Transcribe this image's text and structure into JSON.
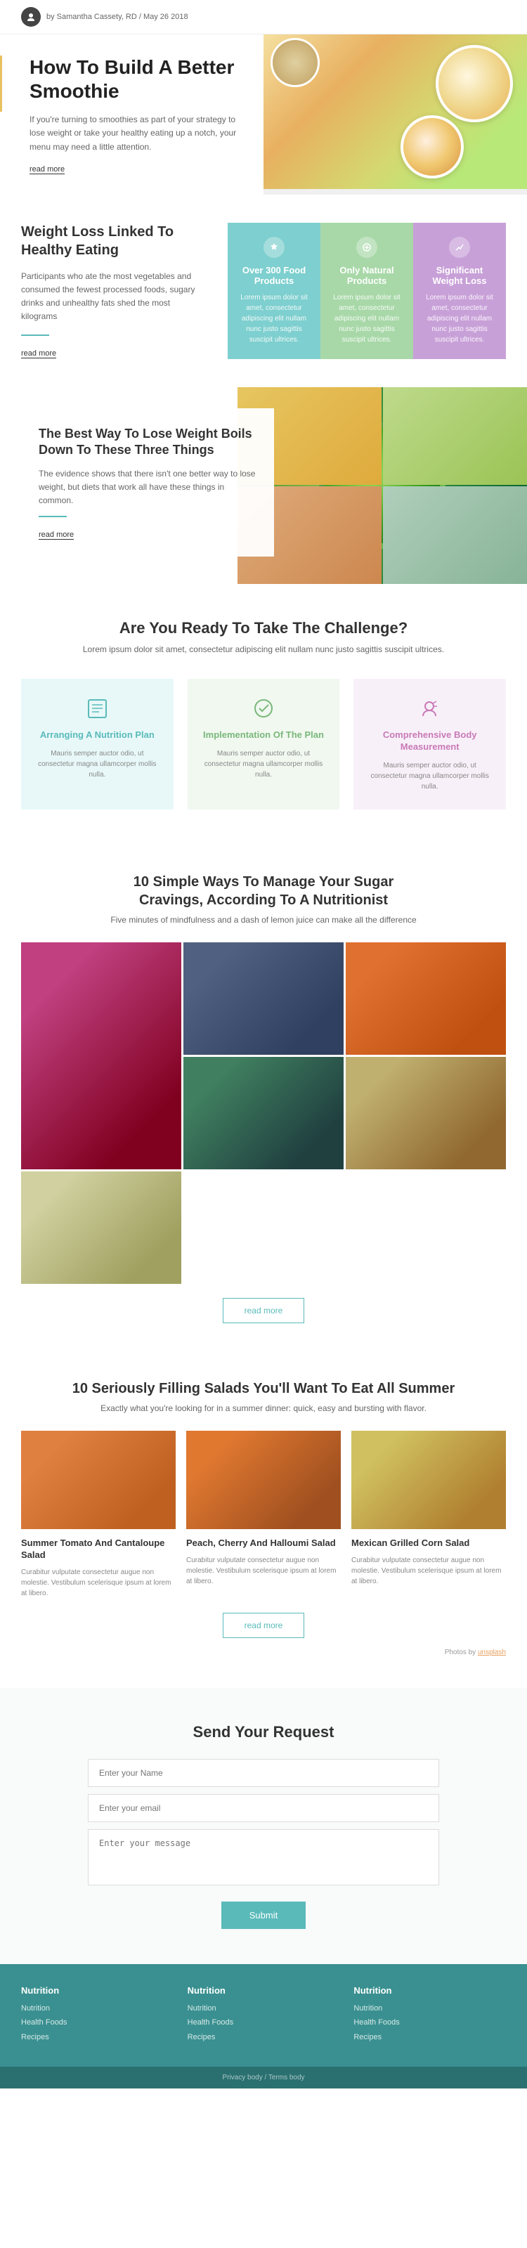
{
  "header": {
    "author": "by Samantha Cassety, RD / May 26 2018",
    "logo_alt": "Site logo"
  },
  "hero": {
    "title": "How To Build A Better Smoothie",
    "text": "If you're turning to smoothies as part of your strategy to lose weight or take your healthy eating up a notch, your menu may need a little attention.",
    "read_more": "read more"
  },
  "weight_section": {
    "title": "Weight Loss Linked To Healthy Eating",
    "text": "Participants who ate the most vegetables and consumed the fewest processed foods, sugary drinks and unhealthy fats shed the most kilograms",
    "read_more": "read more",
    "cards": [
      {
        "title": "Over 300 Food Products",
        "text": "Lorem ipsum dolor sit amet, consectetur adipiscing elit nullam nunc justo sagittis suscipit ultrices.",
        "bg": "teal"
      },
      {
        "title": "Only Natural Products",
        "text": "Lorem ipsum dolor sit amet, consectetur adipiscing elit nullam nunc justo sagittis suscipit ultrices.",
        "bg": "green"
      },
      {
        "title": "Significant Weight Loss",
        "text": "Lorem ipsum dolor sit amet, consectetur adipiscing elit nullam nunc justo sagittis suscipit ultrices.",
        "bg": "purple"
      }
    ]
  },
  "best_way": {
    "title": "The Best Way To Lose Weight Boils Down To These Three Things",
    "text": "The evidence shows that there isn't one better way to lose weight, but diets that work all have these things in common.",
    "read_more": "read more"
  },
  "challenge": {
    "title": "Are You Ready To Take The Challenge?",
    "subtitle": "Lorem ipsum dolor sit amet, consectetur adipiscing elit nullam nunc justo sagittis suscipit ultrices.",
    "cards": [
      {
        "title": "Arranging A Nutrition Plan",
        "text": "Mauris semper auctor odio, ut consectetur magna ullamcorper mollis nulla.",
        "bg": "bg-teal"
      },
      {
        "title": "Implementation Of The Plan",
        "text": "Mauris semper auctor odio, ut consectetur magna ullamcorper mollis nulla.",
        "bg": "bg-green"
      },
      {
        "title": "Comprehensive Body Measurement",
        "text": "Mauris semper auctor odio, ut consectetur magna ullamcorper mollis nulla.",
        "bg": "bg-pink"
      }
    ]
  },
  "sugar": {
    "title": "10 Simple Ways To Manage Your Sugar Cravings, According To A Nutritionist",
    "subtitle": "Five minutes of mindfulness and a dash of lemon juice can make all the difference",
    "read_more": "read more"
  },
  "salads": {
    "title": "10 Seriously Filling Salads You'll Want To Eat All Summer",
    "subtitle": "Exactly what you're looking for in a summer dinner: quick, easy and bursting with flavor.",
    "photos_by": "Photos by",
    "photos_by_link": "unsplash",
    "read_more": "read more",
    "cards": [
      {
        "title": "Summer Tomato And Cantaloupe Salad",
        "text": "Curabitur vulputate consectetur augue non molestie. Vestibulum scelerisque ipsum at lorem at libero.",
        "img": "s1"
      },
      {
        "title": "Peach, Cherry And Halloumi Salad",
        "text": "Curabitur vulputate consectetur augue non molestie. Vestibulum scelerisque ipsum at lorem at libero.",
        "img": "s2"
      },
      {
        "title": "Mexican Grilled Corn Salad",
        "text": "Curabitur vulputate consectetur augue non molestie. Vestibulum scelerisque ipsum at lorem at libero.",
        "img": "s3"
      }
    ]
  },
  "contact": {
    "title": "Send Your Request",
    "name_placeholder": "Enter your Name",
    "email_placeholder": "Enter your email",
    "message_placeholder": "Enter your message",
    "submit_label": "Submit"
  },
  "footer": {
    "cols": [
      {
        "title": "Nutrition",
        "links": [
          "Nutrition",
          "Health Foods",
          "Recipes"
        ]
      },
      {
        "title": "Nutrition",
        "links": [
          "Nutrition",
          "Health Foods",
          "Recipes"
        ]
      },
      {
        "title": "Nutrition",
        "links": [
          "Nutrition",
          "Health Foods",
          "Recipes"
        ]
      }
    ],
    "bottom": "Privacy body / Terms body"
  }
}
